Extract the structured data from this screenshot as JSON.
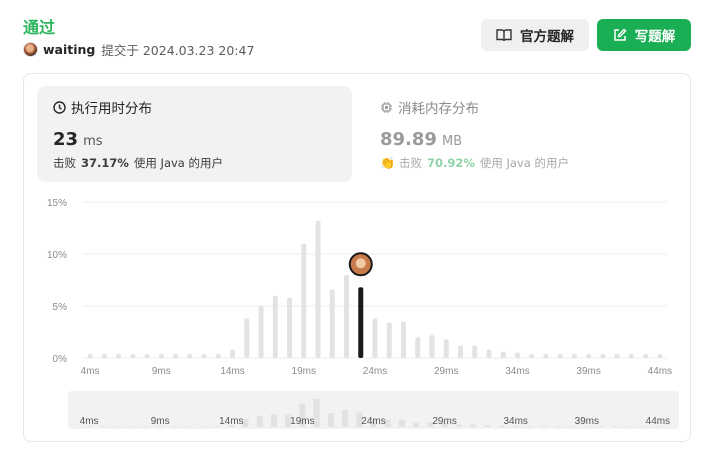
{
  "header": {
    "status": "通过",
    "username": "waiting",
    "submitted_at": "提交于 2024.03.23 20:47",
    "solutions_label": "官方题解",
    "write_label": "写题解"
  },
  "runtime": {
    "title": "执行用时分布",
    "value": "23",
    "unit": "ms",
    "beats_prefix": "击败",
    "beats_pct": "37.17%",
    "beats_suffix": "使用 Java 的用户"
  },
  "memory": {
    "title": "消耗内存分布",
    "value": "89.89",
    "unit": "MB",
    "beats_prefix": "击败",
    "beats_pct": "70.92%",
    "beats_suffix": "使用 Java 的用户"
  },
  "colors": {
    "accent": "#2db55d",
    "button": "#1aae55",
    "bar": "#e3e3e3",
    "highlight": "#1a1a1a"
  },
  "chart_data": {
    "type": "bar",
    "title": "",
    "xlabel": "",
    "ylabel": "",
    "ylim": [
      0,
      15
    ],
    "yticks": [
      "0%",
      "5%",
      "10%",
      "15%"
    ],
    "ytick_values": [
      0,
      5,
      10,
      15
    ],
    "x": [
      4,
      5,
      6,
      7,
      8,
      9,
      10,
      11,
      12,
      13,
      14,
      15,
      16,
      17,
      18,
      19,
      20,
      21,
      22,
      23,
      24,
      25,
      26,
      27,
      28,
      29,
      30,
      31,
      32,
      33,
      34,
      35,
      36,
      37,
      38,
      39,
      40,
      41,
      42,
      43,
      44
    ],
    "x_tick_labels": [
      "4ms",
      "9ms",
      "14ms",
      "19ms",
      "24ms",
      "29ms",
      "34ms",
      "39ms",
      "44ms"
    ],
    "x_tick_values": [
      4,
      9,
      14,
      19,
      24,
      29,
      34,
      39,
      44
    ],
    "values": [
      0.4,
      0.4,
      0.4,
      0.4,
      0.4,
      0.4,
      0.4,
      0.4,
      0.4,
      0.4,
      0.8,
      3.8,
      5.0,
      6.0,
      5.8,
      11.0,
      13.2,
      6.6,
      8.0,
      6.8,
      3.8,
      3.4,
      3.5,
      2.0,
      2.2,
      1.8,
      1.2,
      1.2,
      0.8,
      0.6,
      0.5,
      0.4,
      0.4,
      0.4,
      0.4,
      0.4,
      0.4,
      0.4,
      0.4,
      0.4,
      0.4
    ],
    "highlight_x": 23,
    "overview_tick_labels": [
      "4ms",
      "9ms",
      "14ms",
      "19ms",
      "24ms",
      "29ms",
      "34ms",
      "39ms",
      "44ms"
    ]
  }
}
